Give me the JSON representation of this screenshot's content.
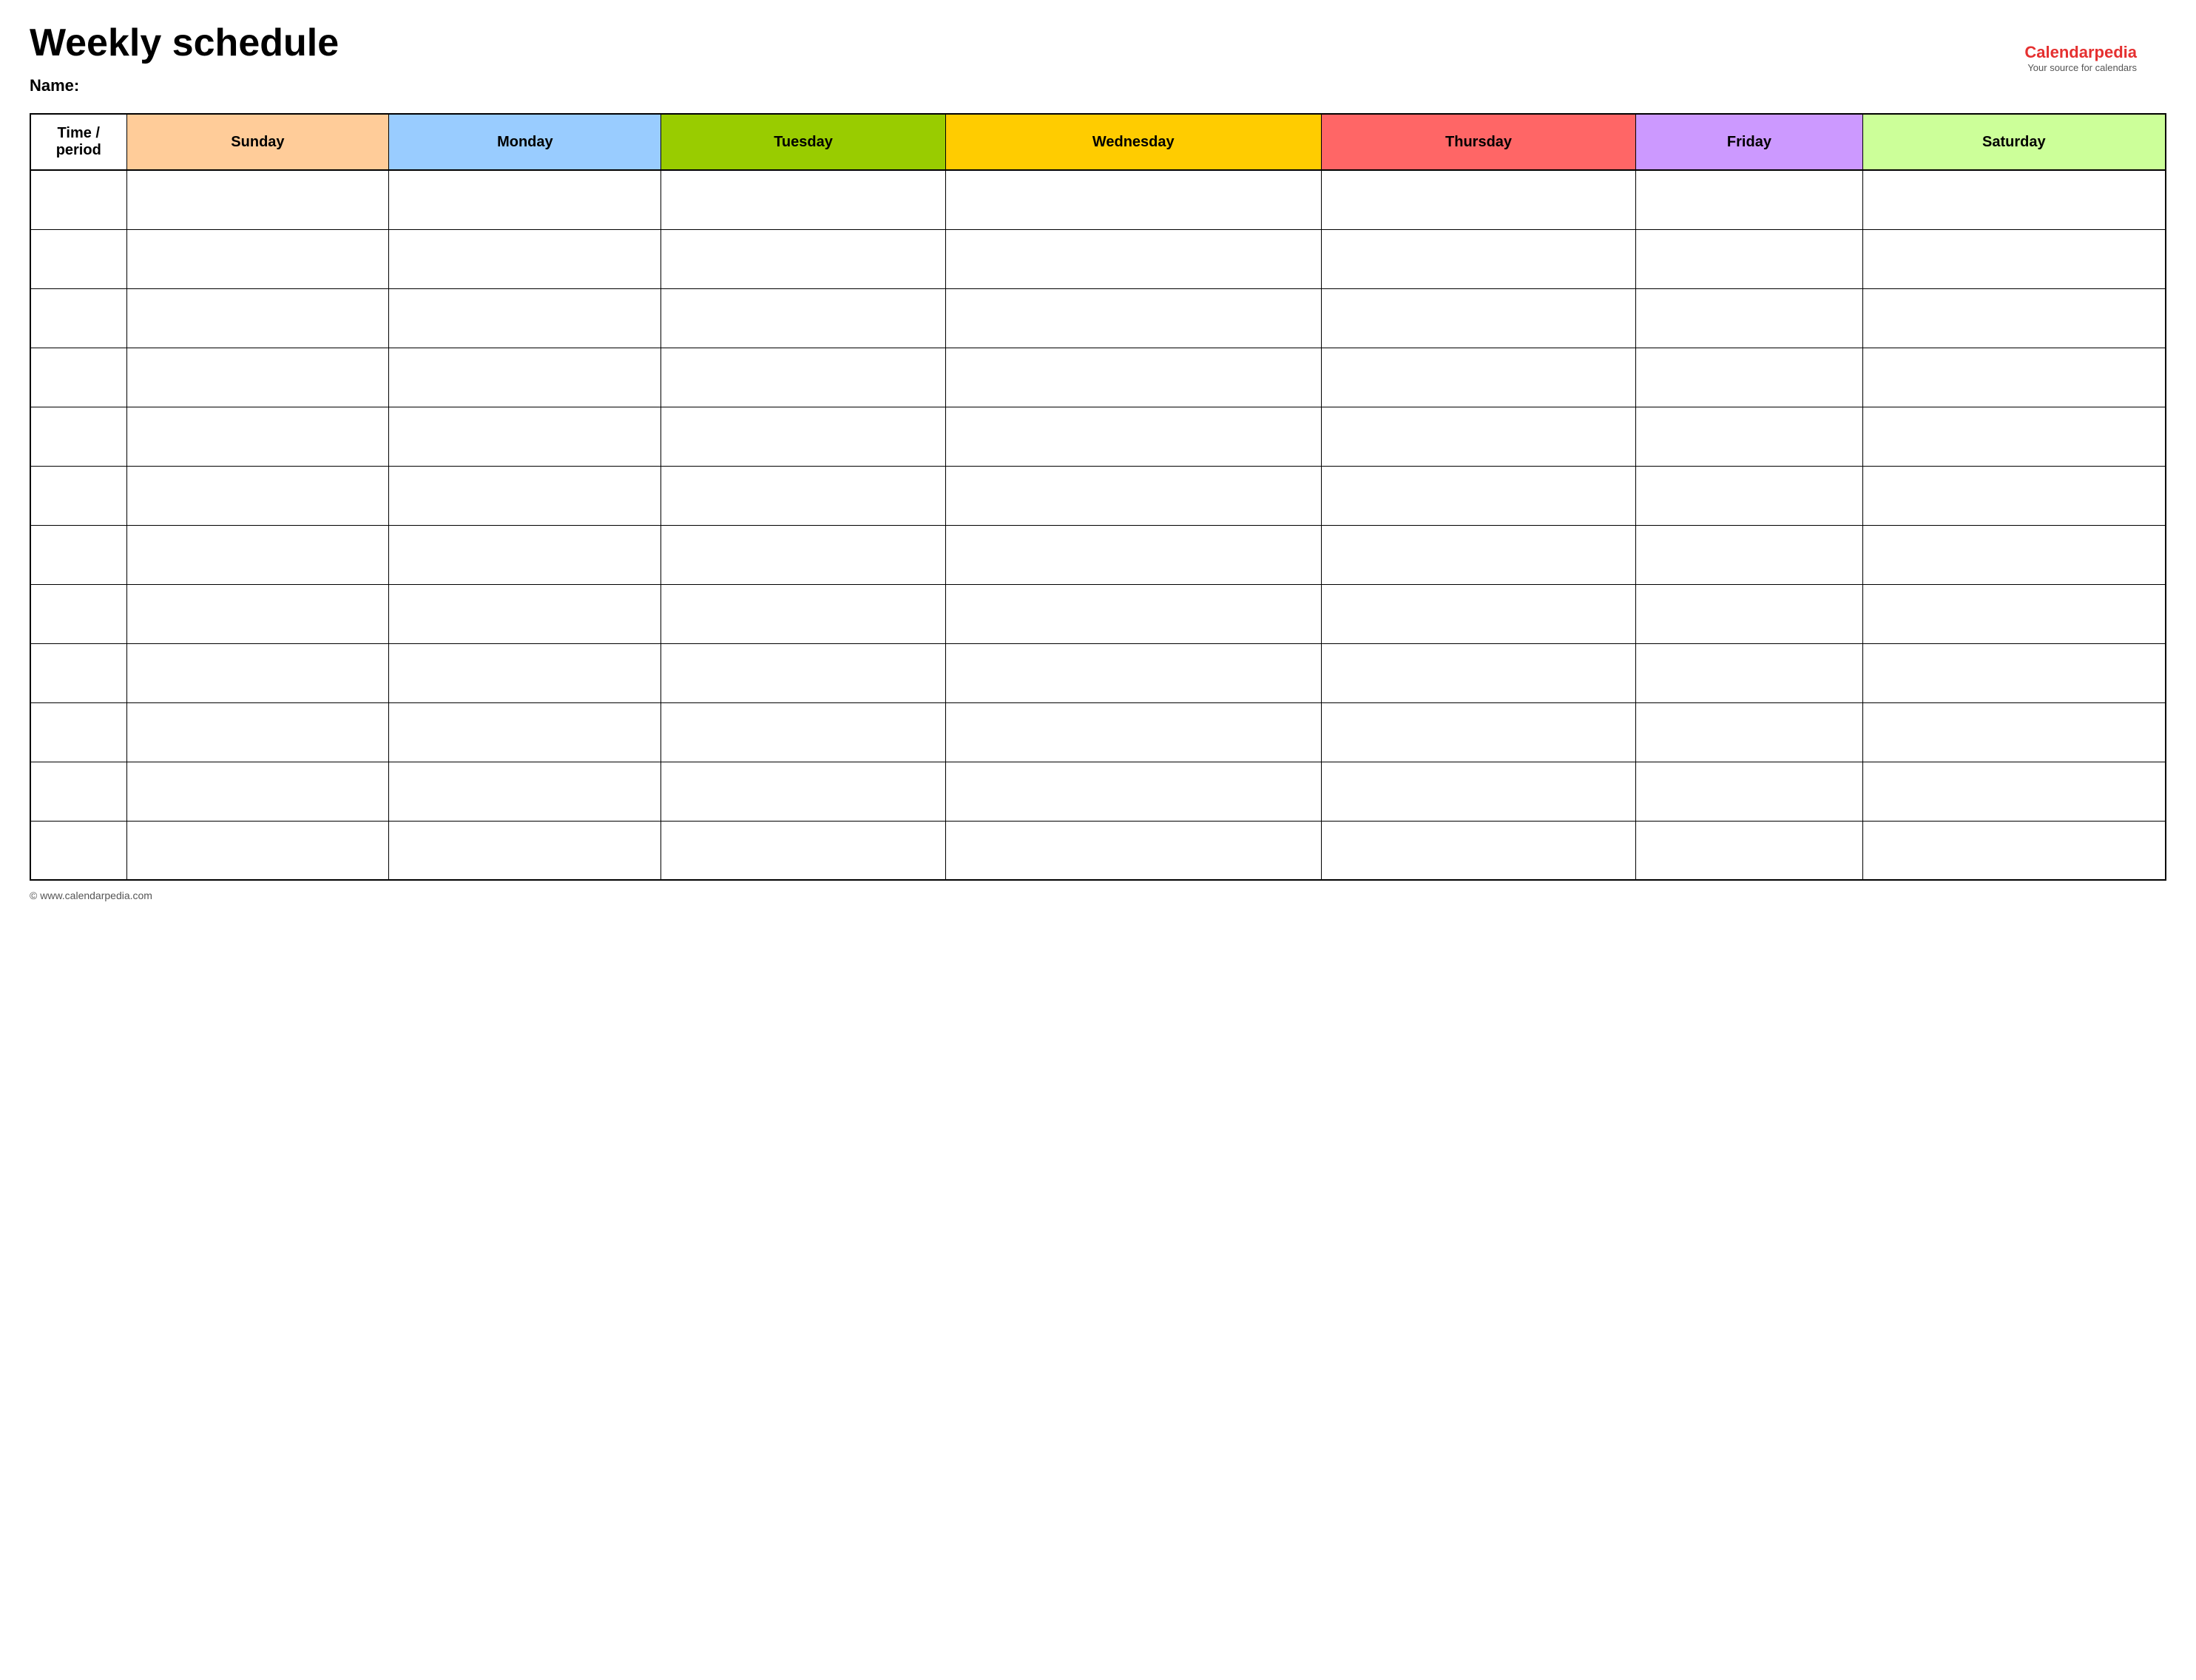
{
  "page": {
    "title": "Weekly schedule",
    "name_label": "Name:",
    "footer_url": "www.calendarpedia.com"
  },
  "logo": {
    "brand": "Calendar",
    "brand_accent": "pedia",
    "tagline": "Your source for calendars"
  },
  "table": {
    "headers": [
      {
        "id": "time",
        "label": "Time / period",
        "color_class": "header-time"
      },
      {
        "id": "sunday",
        "label": "Sunday",
        "color_class": "header-sunday"
      },
      {
        "id": "monday",
        "label": "Monday",
        "color_class": "header-monday"
      },
      {
        "id": "tuesday",
        "label": "Tuesday",
        "color_class": "header-tuesday"
      },
      {
        "id": "wednesday",
        "label": "Wednesday",
        "color_class": "header-wednesday"
      },
      {
        "id": "thursday",
        "label": "Thursday",
        "color_class": "header-thursday"
      },
      {
        "id": "friday",
        "label": "Friday",
        "color_class": "header-friday"
      },
      {
        "id": "saturday",
        "label": "Saturday",
        "color_class": "header-saturday"
      }
    ],
    "row_count": 12
  }
}
